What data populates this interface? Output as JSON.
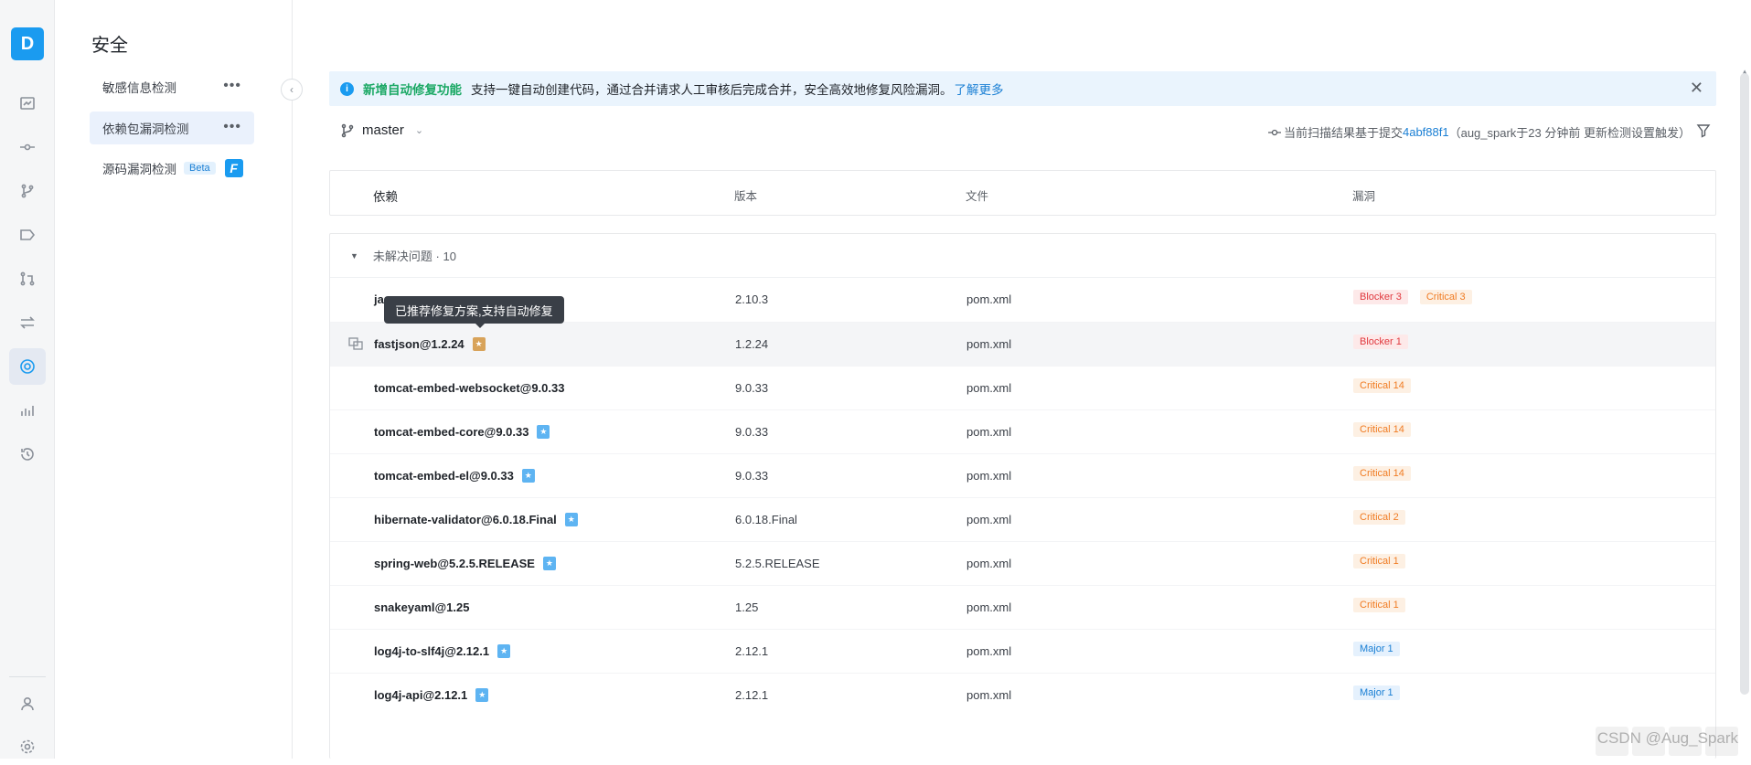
{
  "rail": {
    "avatar": "D",
    "icons": [
      "dashboard-icon",
      "commit-icon",
      "branch-icon",
      "tag-icon",
      "merge-request-icon",
      "compare-icon",
      "security-icon",
      "analytics-icon",
      "history-icon"
    ],
    "bottom_icons": [
      "user-icon",
      "settings-icon"
    ]
  },
  "subnav": {
    "title": "安全",
    "items": [
      {
        "label": "敏感信息检测",
        "more": "•••"
      },
      {
        "label": "依赖包漏洞检测",
        "more": "•••"
      },
      {
        "label": "源码漏洞检测",
        "badge": "Beta"
      }
    ],
    "collapse_glyph": "‹",
    "logo_letter": "F"
  },
  "banner": {
    "info_glyph": "i",
    "strong": "新增自动修复功能",
    "text": "支持一键自动创建代码，通过合并请求人工审核后完成合并，安全高效地修复风险漏洞。",
    "link": "了解更多",
    "close_glyph": "✕"
  },
  "branch": {
    "name": "master",
    "chevron": "⌄"
  },
  "scan": {
    "prefix": "当前扫描结果基于提交",
    "commit": "4abf88f1",
    "suffix": "（aug_spark于23 分钟前 更新检测设置触发）"
  },
  "table": {
    "headers": {
      "dep": "依赖",
      "version": "版本",
      "file": "文件",
      "vuln": "漏洞"
    },
    "group": {
      "label": "未解决问题 · 10",
      "toggle": "▼"
    },
    "rows": [
      {
        "dep": "jac",
        "version": "2.10.3",
        "file": "pom.xml",
        "tags": [
          {
            "text": "Blocker 3",
            "kind": "blocker"
          },
          {
            "text": "Critical 3",
            "kind": "critical"
          }
        ],
        "badge": ""
      },
      {
        "dep": "fastjson@1.2.24",
        "version": "1.2.24",
        "file": "pom.xml",
        "tags": [
          {
            "text": "Blocker 1",
            "kind": "blocker"
          }
        ],
        "badge": "gold"
      },
      {
        "dep": "tomcat-embed-websocket@9.0.33",
        "version": "9.0.33",
        "file": "pom.xml",
        "tags": [
          {
            "text": "Critical 14",
            "kind": "critical"
          }
        ],
        "badge": ""
      },
      {
        "dep": "tomcat-embed-core@9.0.33",
        "version": "9.0.33",
        "file": "pom.xml",
        "tags": [
          {
            "text": "Critical 14",
            "kind": "critical"
          }
        ],
        "badge": "blue"
      },
      {
        "dep": "tomcat-embed-el@9.0.33",
        "version": "9.0.33",
        "file": "pom.xml",
        "tags": [
          {
            "text": "Critical 14",
            "kind": "critical"
          }
        ],
        "badge": "blue"
      },
      {
        "dep": "hibernate-validator@6.0.18.Final",
        "version": "6.0.18.Final",
        "file": "pom.xml",
        "tags": [
          {
            "text": "Critical 2",
            "kind": "critical"
          }
        ],
        "badge": "blue"
      },
      {
        "dep": "spring-web@5.2.5.RELEASE",
        "version": "5.2.5.RELEASE",
        "file": "pom.xml",
        "tags": [
          {
            "text": "Critical 1",
            "kind": "critical"
          }
        ],
        "badge": "blue"
      },
      {
        "dep": "snakeyaml@1.25",
        "version": "1.25",
        "file": "pom.xml",
        "tags": [
          {
            "text": "Critical 1",
            "kind": "critical"
          }
        ],
        "badge": ""
      },
      {
        "dep": "log4j-to-slf4j@2.12.1",
        "version": "2.12.1",
        "file": "pom.xml",
        "tags": [
          {
            "text": "Major 1",
            "kind": "major"
          }
        ],
        "badge": "blue"
      },
      {
        "dep": "log4j-api@2.12.1",
        "version": "2.12.1",
        "file": "pom.xml",
        "tags": [
          {
            "text": "Major 1",
            "kind": "major"
          }
        ],
        "badge": "blue"
      }
    ]
  },
  "tooltip": "已推荐修复方案,支持自动修复",
  "badge_glyph": "★",
  "watermark": "CSDN @Aug_Spark",
  "colors": {
    "accent": "#1a9bf0",
    "blocker": "#e0383e",
    "critical": "#f07b22",
    "major": "#1a7fd4",
    "success": "#1aa864"
  }
}
